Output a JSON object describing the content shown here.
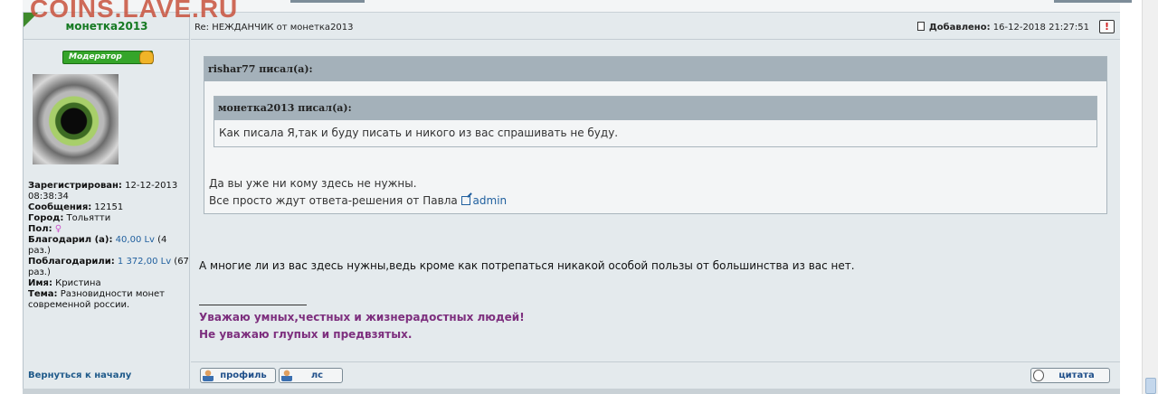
{
  "watermark": "COINS.LAVE.RU",
  "post": {
    "author": "монетка2013",
    "subject": "Re: НЕЖДАНЧИК от монетка2013",
    "added_label": "Добавлено:",
    "added_value": "16-12-2018 21:27:51",
    "report_symbol": "!"
  },
  "profile": {
    "badge": "Модератор",
    "registered_label": "Зарегистрирован:",
    "registered_value": "12-12-2013 08:38:34",
    "messages_label": "Сообщения:",
    "messages_value": "12151",
    "city_label": "Город:",
    "city_value": "Тольятти",
    "gender_label": "Пол:",
    "gender_value": "♀",
    "thanked_label": "Благодарил (а):",
    "thanked_amount": "40,00 Lv",
    "thanked_count": "(4 раз.)",
    "thanked_by_label": "Поблагодарили:",
    "thanked_by_amount": "1 372,00 Lv",
    "thanked_by_count": "(67 раз.)",
    "name_label": "Имя:",
    "name_value": "Кристина",
    "theme_label": "Тема:",
    "theme_value": "Разновидности монет современной россии."
  },
  "back_to_top": "Вернуться к началу",
  "quote_outer": {
    "header": "rishar77 писал(а):",
    "line1": "Да вы уже ни кому здесь не нужны.",
    "line2_prefix": "Все просто ждут ответа-решения от Павла ",
    "link": "admin"
  },
  "quote_inner": {
    "header": "монетка2013 писал(а):",
    "text": "Как писала Я,так и буду писать и никого из вас спрашивать не буду."
  },
  "message": "А многие ли из вас здесь нужны,ведь кроме как потрепаться никакой особой пользы от большинства из вас нет.",
  "signature": {
    "line1": "Уважаю умных,честных и жизнерадостных людей!",
    "line2": "Не уважаю глупых и предвзятых."
  },
  "buttons": {
    "profile": "профиль",
    "pm": "лс",
    "quote": "цитата"
  },
  "colors": {
    "username": "#167a23",
    "signature": "#7d2f7e",
    "link": "#1f5f9e",
    "quote_header": "#a4b1ba",
    "panel": "#e4eaed"
  }
}
